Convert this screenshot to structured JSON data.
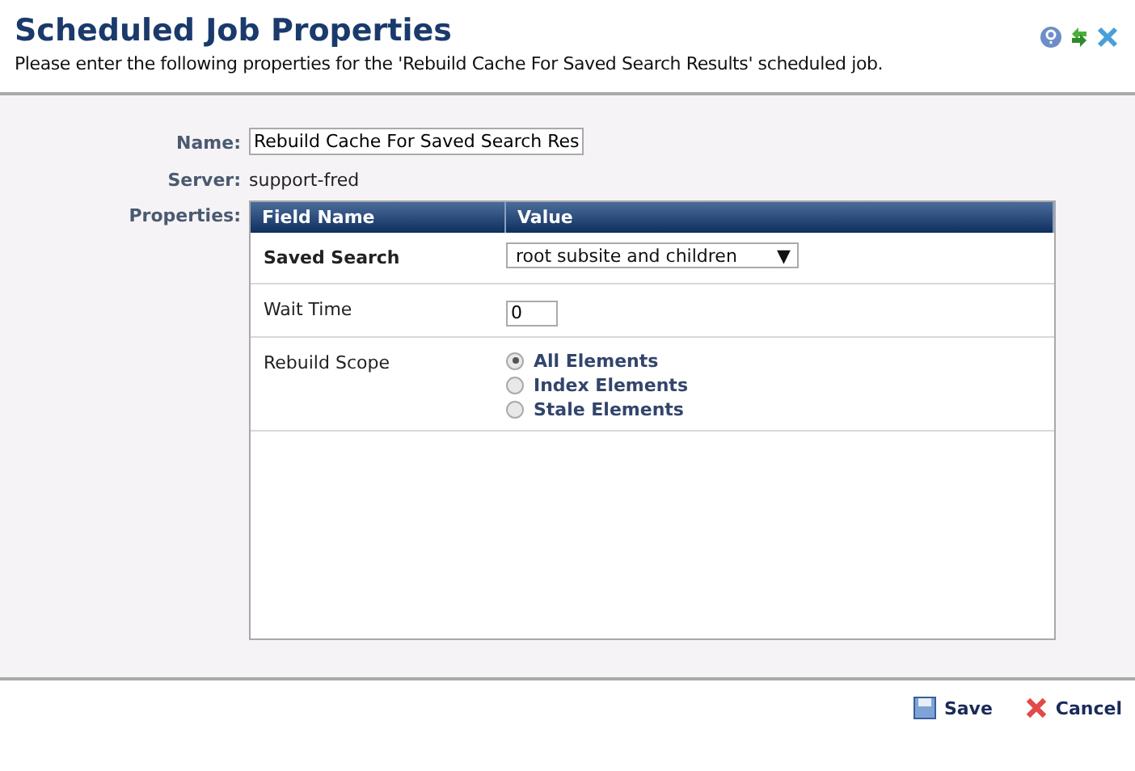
{
  "header": {
    "title": "Scheduled Job Properties",
    "subtitle": "Please enter the following properties for the 'Rebuild Cache For Saved Search Results' scheduled job."
  },
  "form": {
    "name_label": "Name:",
    "name_value": "Rebuild Cache For Saved Search Res",
    "server_label": "Server:",
    "server_value": "support-fred",
    "properties_label": "Properties:"
  },
  "table": {
    "columns": [
      "Field Name",
      "Value"
    ],
    "rows": [
      {
        "kind": "select",
        "field": "Saved Search",
        "bold": true,
        "value": "root subsite and children",
        "caret": "▼"
      },
      {
        "kind": "input",
        "field": "Wait Time",
        "bold": false,
        "value": "0"
      },
      {
        "kind": "radio",
        "field": "Rebuild Scope",
        "bold": false,
        "options": [
          {
            "label": "All Elements",
            "selected": true
          },
          {
            "label": "Index Elements",
            "selected": false
          },
          {
            "label": "Stale Elements",
            "selected": false
          }
        ]
      }
    ]
  },
  "buttons": [
    {
      "kind": "save",
      "label": "Save"
    },
    {
      "kind": "cancel",
      "label": "Cancel"
    }
  ]
}
